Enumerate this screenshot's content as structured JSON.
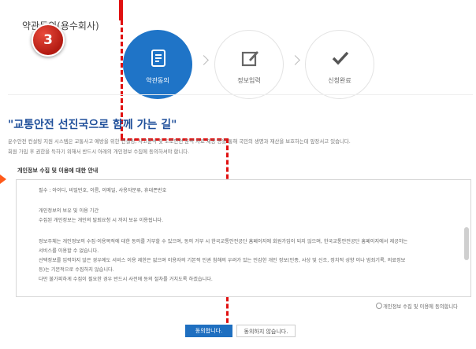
{
  "header": {
    "title": "약관동의(용수회사)"
  },
  "badge": {
    "number": "3"
  },
  "steps": [
    {
      "label": "약관동의",
      "icon": "document-icon",
      "active": true
    },
    {
      "label": "정보입력",
      "icon": "edit-icon",
      "active": false
    },
    {
      "label": "신청완료",
      "icon": "check-icon",
      "active": false
    }
  ],
  "intro": {
    "slogan": "\"교통안전 선진국으로 함께 가는 길\"",
    "line1": "운수안전 컨설팅 지원 시스템은 교통사고 예방을 위한 컨설팅, 사고분석 및 도로안전 분석 자료 제공 등을 통해 국민의 생명과 재산을 보호하는데 앞장서고 있습니다.",
    "line2": "회원 가입 후 권한을 득하기 위해서 반드시 아래의 개인정보 수집에 동의하셔야 합니다."
  },
  "privacy": {
    "section_title": "개인정보 수집 및 이용에 대한 안내",
    "lines": [
      "필수 : 아이디, 비밀번호, 이름, 이메일, 사용자분류, 휴대폰번호",
      "개인정보의 보유 및 이용 기간",
      "수집된 개인정보는 개인의 탈퇴요청 시 까지 보유 이용됩니다.",
      "정보주체는 개인정보의 수집·이용목적에 대한 동의를 거부할 수 있으며, 동의 거부 시 한국교통안전공단 홈페이지에 회원가입이 되지 않으며, 한국교통안전공단 홈페이지에서 제공하는",
      "서비스를 이용할 수 없습니다.",
      "선택정보를 입력하지 않은 경우에도 서비스 이용 제한은 없으며 이용자의 기본적 인권 침해의 우려가 있는 민감한 개인 정보(인종, 사상 및 신조, 정치적 성향 이나 범죄기록, 의료정보",
      "등)는 기본적으로 수집하지 않습니다.",
      "다만 불가피하게 수집이 필요한 경우 반드시 사전에 동의 절차를 거치도록 하겠습니다."
    ],
    "consent_label": "개인정보 수집 및 이용에 동의합니다"
  },
  "buttons": {
    "agree": "동의합니다.",
    "disagree": "동의하지 않습니다."
  }
}
